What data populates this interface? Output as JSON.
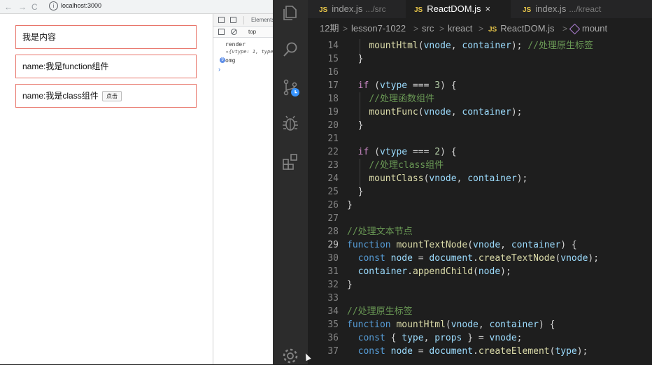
{
  "browser": {
    "url": "localhost:3000",
    "nav": {
      "back": "←",
      "forward": "→",
      "reload": "C",
      "info": "i"
    },
    "page": {
      "box1": "我是内容",
      "box2": "name:我是function组件",
      "box3": "name:我是class组件",
      "click_label": "点击"
    },
    "devtools": {
      "tab_label": "Elements",
      "context": "top",
      "log1": "render",
      "log2": "▸{vtype: 1, type:",
      "log3": "omg",
      "log3_badge": "9",
      "prompt": "›"
    }
  },
  "vscode": {
    "tabs": [
      {
        "js": "JS",
        "label": "index.js",
        "sub": ".../src"
      },
      {
        "js": "JS",
        "label": "ReactDOM.js",
        "close": "×"
      },
      {
        "js": "JS",
        "label": "index.js",
        "sub": ".../kreact"
      }
    ],
    "breadcrumb": [
      "12期",
      "lesson7-1022",
      "src",
      "kreact",
      "ReactDOM.js",
      "mount"
    ],
    "breadcrumb_sep": ">",
    "breadcrumb_js": "JS",
    "line_numbers": [
      "14",
      "15",
      "16",
      "17",
      "18",
      "19",
      "20",
      "21",
      "22",
      "23",
      "24",
      "25",
      "26",
      "27",
      "28",
      "29",
      "30",
      "31",
      "32",
      "33",
      "34",
      "35",
      "36",
      "37"
    ],
    "current_line": "29",
    "code_lines": [
      "    mountHtml(vnode, container); //处理原生标签",
      "  }",
      "",
      "  if (vtype === 3) {",
      "    //处理函数组件",
      "    mountFunc(vnode, container);",
      "  }",
      "",
      "  if (vtype === 2) {",
      "    //处理class组件",
      "    mountClass(vnode, container);",
      "  }",
      "}",
      "",
      "//处理文本节点",
      "function mountTextNode(vnode, container) {",
      "  const node = document.createTextNode(vnode);",
      "  container.appendChild(node);",
      "}",
      "",
      "//处理原生标签",
      "function mountHtml(vnode, container) {",
      "  const { type, props } = vnode;",
      "  const node = document.createElement(type);"
    ]
  },
  "colors": {
    "editor_bg": "#1e1e1e",
    "keyword": "#569cd6",
    "control": "#c586c0",
    "function": "#dcdcaa",
    "variable": "#9cdcfe",
    "number": "#b5cea8",
    "comment": "#6a9955",
    "box_border": "#e8756a"
  },
  "icons": [
    "explorer-icon",
    "search-icon",
    "source-control-icon",
    "debug-icon",
    "extensions-icon",
    "settings-icon"
  ]
}
